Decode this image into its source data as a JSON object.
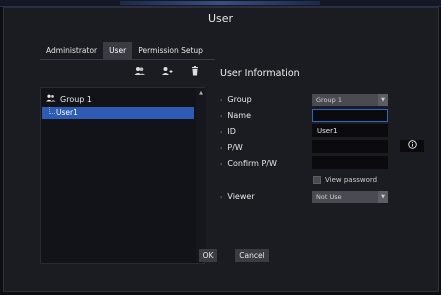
{
  "window": {
    "title": "User"
  },
  "tabs": [
    {
      "label": "Administrator",
      "active": false
    },
    {
      "label": "User",
      "active": true
    },
    {
      "label": "Permission Setup",
      "active": false
    }
  ],
  "toolbar": {
    "icons": [
      "group-add-icon",
      "user-add-icon",
      "trash-icon"
    ]
  },
  "tree": {
    "group_label": "Group 1",
    "selected_user": "User1"
  },
  "info": {
    "title": "User Information",
    "group_label": "Group",
    "group_value": "Group 1",
    "name_label": "Name",
    "name_value": "",
    "id_label": "ID",
    "id_value": "User1",
    "pw_label": "P/W",
    "pw_value": "",
    "confirm_label": "Confirm P/W",
    "confirm_value": "",
    "view_password_label": "View password",
    "viewer_label": "Viewer",
    "viewer_value": "Not Use",
    "info_icon": "info-icon"
  },
  "footer": {
    "ok_label": "OK",
    "cancel_label": "Cancel"
  },
  "colors": {
    "accent": "#2e5cb5",
    "background": "#1b1c21",
    "focus": "#2d66c7"
  }
}
